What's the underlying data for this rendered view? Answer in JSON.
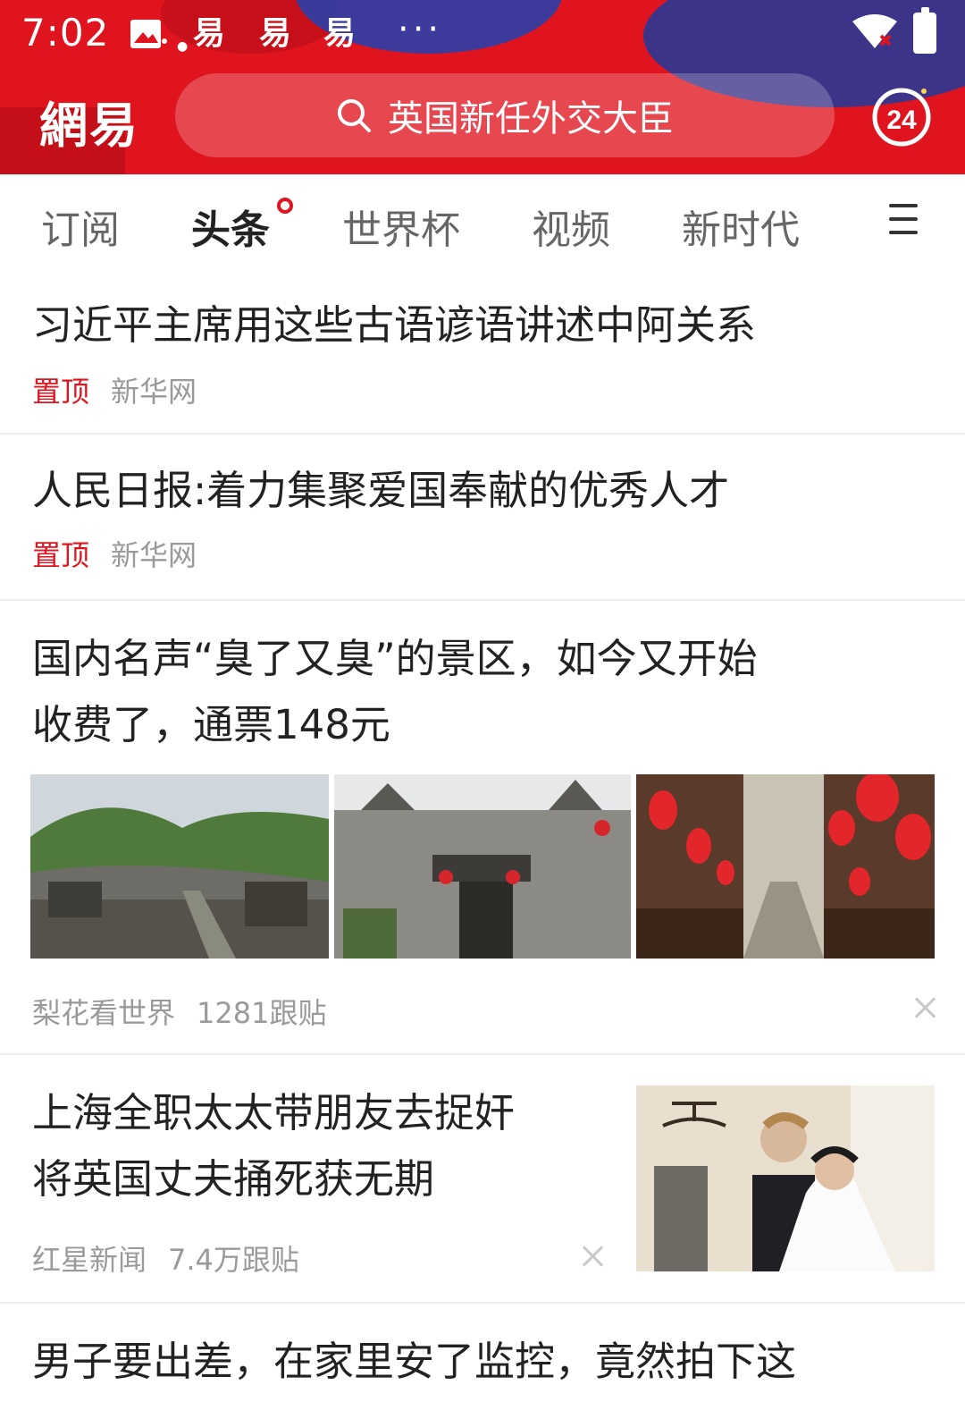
{
  "status_bar": {
    "time": "7:02",
    "notif_icons": [
      "gallery-icon",
      "netease-icon",
      "netease-icon",
      "netease-icon"
    ],
    "more": "···"
  },
  "header": {
    "logo": "網易",
    "search_placeholder": "英国新任外交大臣",
    "badge_24": "24"
  },
  "tabs": [
    {
      "label": "订阅",
      "active": false
    },
    {
      "label": "头条",
      "active": true
    },
    {
      "label": "世界杯",
      "active": false
    },
    {
      "label": "视频",
      "active": false
    },
    {
      "label": "新时代",
      "active": false
    }
  ],
  "feed": [
    {
      "title": "习近平主席用这些古语谚语讲述中阿关系",
      "pin": "置顶",
      "source": "新华网"
    },
    {
      "title": "人民日报:着力集聚爱国奉献的优秀人才",
      "pin": "置顶",
      "source": "新华网"
    },
    {
      "title_line1": "国内名声“臭了又臭”的景区，如今又开始",
      "title_line2": "收费了，通票148元",
      "source": "梨花看世界",
      "comments": "1281跟贴"
    },
    {
      "title_line1": "上海全职太太带朋友去捉奸",
      "title_line2": "将英国丈夫捅死获无期",
      "source": "红星新闻",
      "comments": "7.4万跟贴"
    },
    {
      "title": "男子要出差，在家里安了监控，竟然拍下这"
    }
  ],
  "colors": {
    "brand_red": "#e0141e",
    "meta_gray": "#9a9a9a"
  }
}
